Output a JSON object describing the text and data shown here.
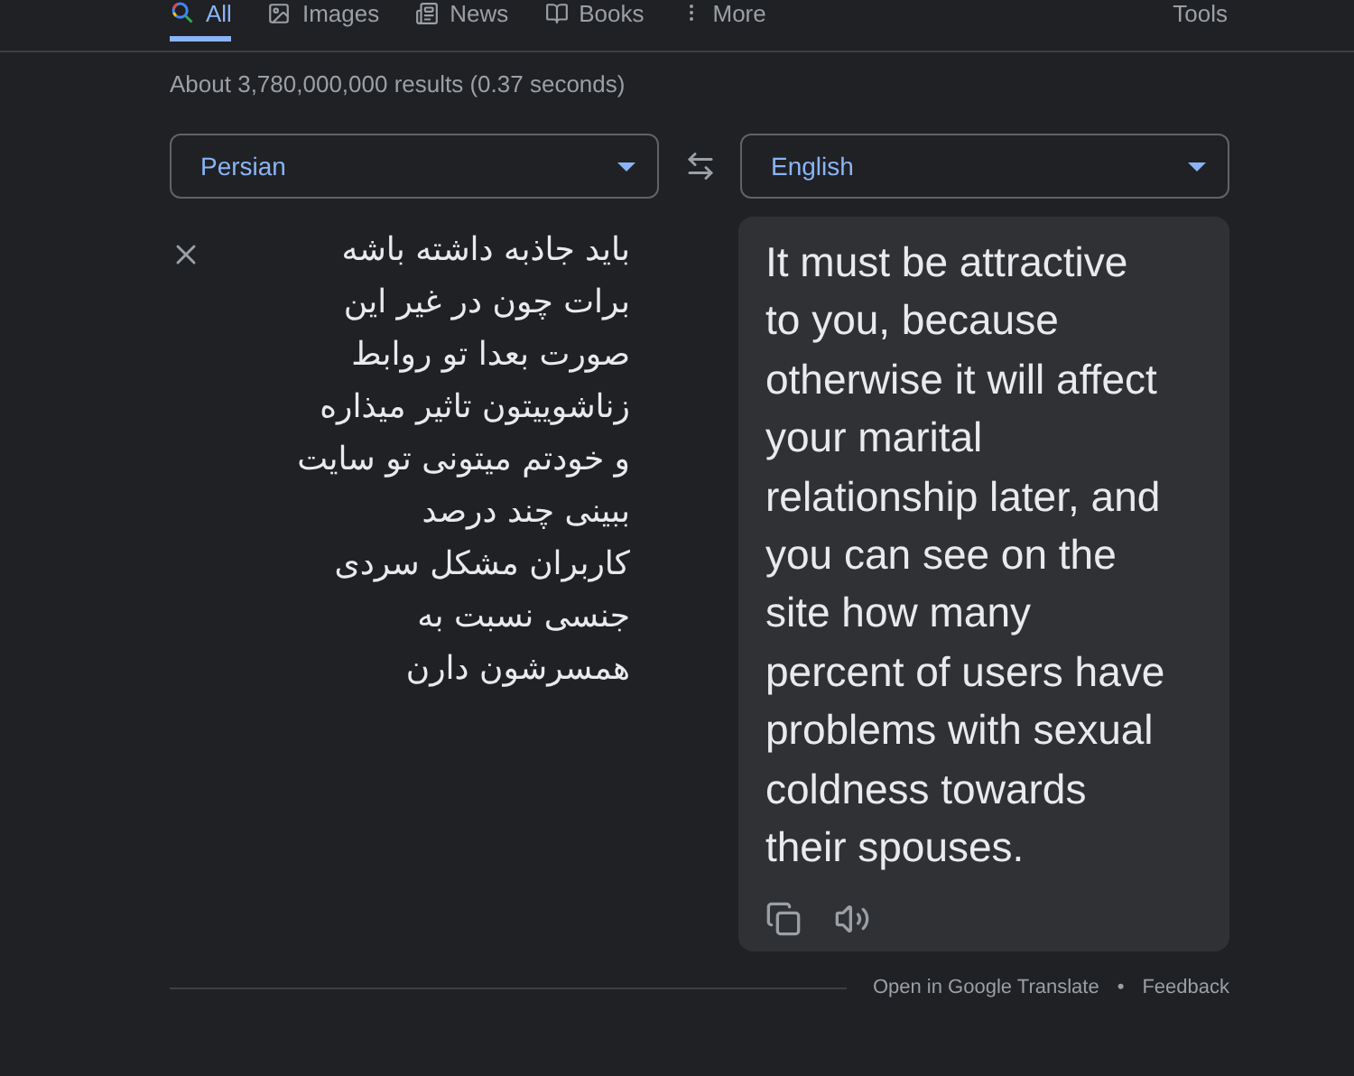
{
  "tabs": [
    {
      "label": "All",
      "selected": true
    },
    {
      "label": "Images",
      "selected": false
    },
    {
      "label": "News",
      "selected": false
    },
    {
      "label": "Books",
      "selected": false
    },
    {
      "label": "More",
      "selected": false
    }
  ],
  "tools": "Tools",
  "result_stats": "About 3,780,000,000 results (0.37 seconds)",
  "translator": {
    "source_language": "Persian",
    "target_language": "English",
    "source_lines": [
      "باید جاذبه داشته باشه",
      "برات چون در غیر این",
      "صورت بعدا تو روابط",
      "زناشوییتون تاثیر میذاره",
      "و خودتم میتونی تو سایت",
      "ببینی چند درصد",
      "کاربران مشکل سردی",
      "جنسی نسبت به",
      "همسرشون دارن"
    ],
    "target_lines": [
      "It must be attractive",
      "to you, because",
      "otherwise it will affect",
      "your marital",
      "relationship later, and",
      "you can see on the",
      "site how many",
      "percent of users have",
      "problems with sexual",
      "coldness towards",
      "their spouses."
    ]
  },
  "footer": {
    "link": "Open in Google Translate",
    "separator": "•",
    "feedback": "Feedback"
  }
}
